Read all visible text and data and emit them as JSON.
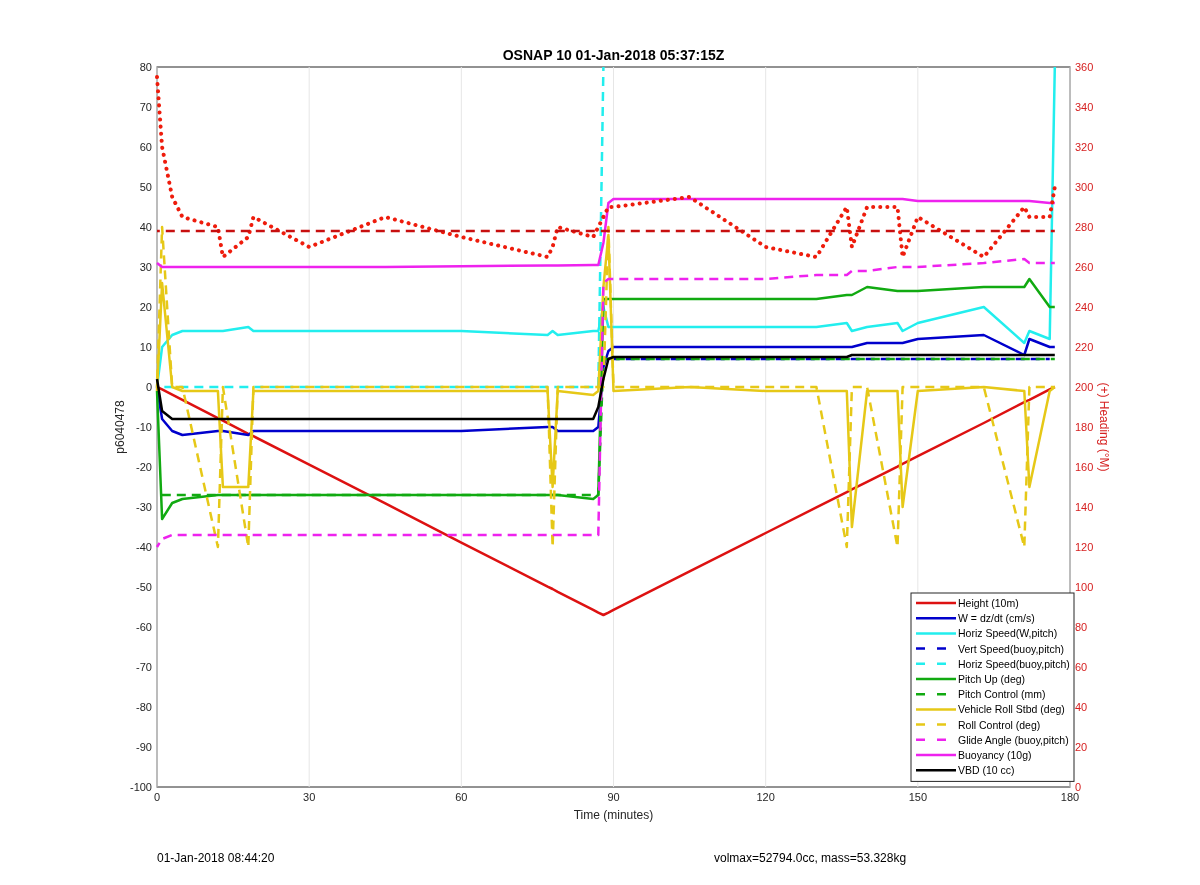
{
  "figure": {
    "footer_left": "01-Jan-2018 08:44:20",
    "footer_right": "volmax=52794.0cc, mass=53.328kg",
    "chart_data": {
      "type": "line",
      "title": "OSNAP 10 01-Jan-2018 05:37:15Z",
      "xlabel": "Time (minutes)",
      "ylabel": "p6040478",
      "y2label": "(+) Heading (°M)",
      "xlim": [
        0,
        180
      ],
      "ylim": [
        -100,
        80
      ],
      "y2lim": [
        0,
        360
      ],
      "xticks": [
        0,
        30,
        60,
        90,
        120,
        150,
        180
      ],
      "yticks": [
        -100,
        -90,
        -80,
        -70,
        -60,
        -50,
        -40,
        -30,
        -20,
        -10,
        0,
        10,
        20,
        30,
        40,
        50,
        60,
        70,
        80
      ],
      "y2ticks": [
        0,
        20,
        40,
        60,
        80,
        100,
        120,
        140,
        160,
        180,
        200,
        220,
        240,
        260,
        280,
        300,
        320,
        340,
        360
      ],
      "x": [
        0,
        1,
        3,
        5,
        12,
        13,
        18,
        19,
        30,
        45,
        60,
        77,
        78,
        79,
        86,
        87,
        88,
        89,
        90,
        105,
        120,
        130,
        136,
        137,
        140,
        146,
        147,
        150,
        163,
        171,
        172,
        176,
        177
      ],
      "series": [
        {
          "name": "Height (10m)",
          "color": "#dd1111",
          "line_style": "solid",
          "values": [
            0,
            -0.6,
            -1.9,
            -3.2,
            -7.8,
            -8.4,
            -11.7,
            -12.3,
            -19.4,
            -29.1,
            -38.9,
            -49.9,
            -50.5,
            -51.2,
            -55.7,
            -56.4,
            -57,
            -56.4,
            -55.7,
            -46.1,
            -36.5,
            -30.1,
            -26.3,
            -25.6,
            -23.7,
            -19.9,
            -19.2,
            -17.3,
            -9,
            -3.8,
            -3.2,
            -0.6,
            0
          ]
        },
        {
          "name": "W = dz/dt (cm/s)",
          "color": "#0000cc",
          "line_style": "solid",
          "values": [
            0,
            -8,
            -11,
            -12,
            -11,
            -11,
            -12,
            -11,
            -11,
            -11,
            -11,
            -10,
            -10,
            -11,
            -11,
            -10,
            5,
            9,
            10,
            10,
            10,
            10,
            10,
            10,
            11,
            11,
            11,
            12,
            13,
            8,
            12,
            10,
            10
          ]
        },
        {
          "name": "Horiz Speed(W,pitch)",
          "color": "#22eeee",
          "line_style": "solid",
          "values": [
            0,
            10,
            13,
            14,
            14,
            14,
            15,
            14,
            14,
            14,
            14,
            13,
            14,
            13,
            14,
            14,
            20,
            15,
            15,
            15,
            15,
            15,
            16,
            14,
            15,
            16,
            14,
            16,
            20,
            11,
            14,
            12,
            80
          ]
        },
        {
          "name": "Vert Speed(buoy,pitch)",
          "color": "#0000cc",
          "line_style": "dashed",
          "values": [
            null,
            null,
            null,
            null,
            null,
            null,
            null,
            null,
            null,
            null,
            null,
            null,
            null,
            null,
            null,
            null,
            7,
            7,
            7,
            7,
            7,
            7,
            7,
            7,
            7,
            7,
            7,
            7,
            7,
            7,
            7,
            7,
            null
          ]
        },
        {
          "name": "Horiz Speed(buoy,pitch)",
          "color": "#22eeee",
          "line_style": "dashed",
          "values": [
            0,
            0,
            0,
            0,
            0,
            0,
            0,
            0,
            0,
            0,
            0,
            0,
            0,
            0,
            0,
            0,
            80,
            null,
            null,
            null,
            null,
            null,
            null,
            null,
            null,
            null,
            null,
            null,
            null,
            null,
            null,
            null,
            null
          ]
        },
        {
          "name": "Pitch Up (deg)",
          "color": "#11aa11",
          "line_style": "solid",
          "values": [
            -1,
            -33,
            -29,
            -28,
            -27,
            -27,
            -27,
            -27,
            -27,
            -27,
            -27,
            -27,
            -27,
            -27,
            -28,
            -27,
            22,
            22,
            22,
            22,
            22,
            22,
            23,
            23,
            25,
            24,
            24,
            24,
            25,
            25,
            27,
            20,
            20
          ]
        },
        {
          "name": "Pitch Control (mm)",
          "color": "#11aa11",
          "line_style": "dashed",
          "values": [
            -27,
            -27,
            -27,
            -27,
            -27,
            -27,
            -27,
            -27,
            -27,
            -27,
            -27,
            -27,
            -27,
            -27,
            -27,
            -27,
            7,
            7,
            7,
            7,
            7,
            7,
            7,
            7,
            7,
            7,
            7,
            7,
            7,
            7,
            7,
            7,
            7
          ]
        },
        {
          "name": "Vehicle Roll Stbd (deg)",
          "color": "#e6c817",
          "line_style": "solid",
          "values": [
            -1,
            26,
            0,
            -1,
            -1,
            -25,
            -25,
            -1,
            -1,
            -1,
            -1,
            -1,
            -25,
            -1,
            -2,
            -1,
            25,
            38,
            -1,
            0,
            -1,
            -1,
            -1,
            -35,
            -1,
            -1,
            -30,
            -1,
            0,
            -1,
            -25,
            -1,
            0
          ]
        },
        {
          "name": "Roll Control (deg)",
          "color": "#e6c817",
          "line_style": "dashed",
          "values": [
            0,
            40,
            0,
            0,
            -40,
            0,
            -40,
            0,
            0,
            0,
            0,
            0,
            -40,
            0,
            0,
            0,
            0,
            40,
            0,
            0,
            0,
            0,
            -40,
            0,
            0,
            -40,
            0,
            0,
            0,
            -40,
            0,
            0,
            0
          ]
        },
        {
          "name": "Glide Angle (buoy,pitch)",
          "color": "#ee22ee",
          "line_style": "dashed",
          "values": [
            -40,
            -38,
            -37,
            -37,
            -37,
            -37,
            -37,
            -37,
            -37,
            -37,
            -37,
            -37,
            -37,
            -37,
            -37,
            -37,
            26,
            27,
            27,
            27,
            27,
            28,
            28,
            29,
            29,
            30,
            30,
            30,
            31,
            32,
            31,
            31,
            31
          ]
        },
        {
          "name": "Buoyancy (10g)",
          "color": "#ee22ee",
          "line_style": "solid",
          "values": [
            31,
            30,
            30,
            30,
            30,
            30,
            30,
            30,
            30,
            30,
            30.2,
            30.4,
            30.4,
            30.4,
            30.5,
            30.5,
            36,
            46,
            47,
            47,
            47,
            47,
            47,
            47,
            47,
            47,
            47,
            46.5,
            46.5,
            46.5,
            46.5,
            46,
            46
          ]
        },
        {
          "name": "VBD (10 cc)",
          "color": "#000000",
          "line_style": "solid",
          "values": [
            2,
            -6,
            -8,
            -8,
            -8,
            -8,
            -8,
            -8,
            -8,
            -8,
            -8,
            -8,
            -8,
            -8,
            -8,
            -5,
            2,
            7,
            7.5,
            7.5,
            7.5,
            7.5,
            7.5,
            8,
            8,
            8,
            8,
            8,
            8,
            8,
            8,
            8,
            8
          ]
        },
        {
          "color": "#ee1c0c",
          "axis": "y2",
          "line_style": "dotted",
          "values": [
            355,
            320,
            295,
            285,
            280,
            265,
            275,
            285,
            270,
            285,
            275,
            265,
            270,
            280,
            275,
            280,
            285,
            290,
            290,
            295,
            270,
            265,
            290,
            270,
            290,
            290,
            265,
            285,
            265,
            290,
            285,
            285,
            300
          ]
        },
        {
          "color": "#c80f0f",
          "axis": "y2",
          "line_style": "dashed",
          "values": [
            278,
            278,
            278,
            278,
            278,
            278,
            278,
            278,
            278,
            278,
            278,
            278,
            278,
            278,
            278,
            278,
            278,
            278,
            278,
            278,
            278,
            278,
            278,
            278,
            278,
            278,
            278,
            278,
            278,
            278,
            278,
            278,
            278
          ]
        }
      ],
      "grid": true,
      "legend": true
    }
  }
}
